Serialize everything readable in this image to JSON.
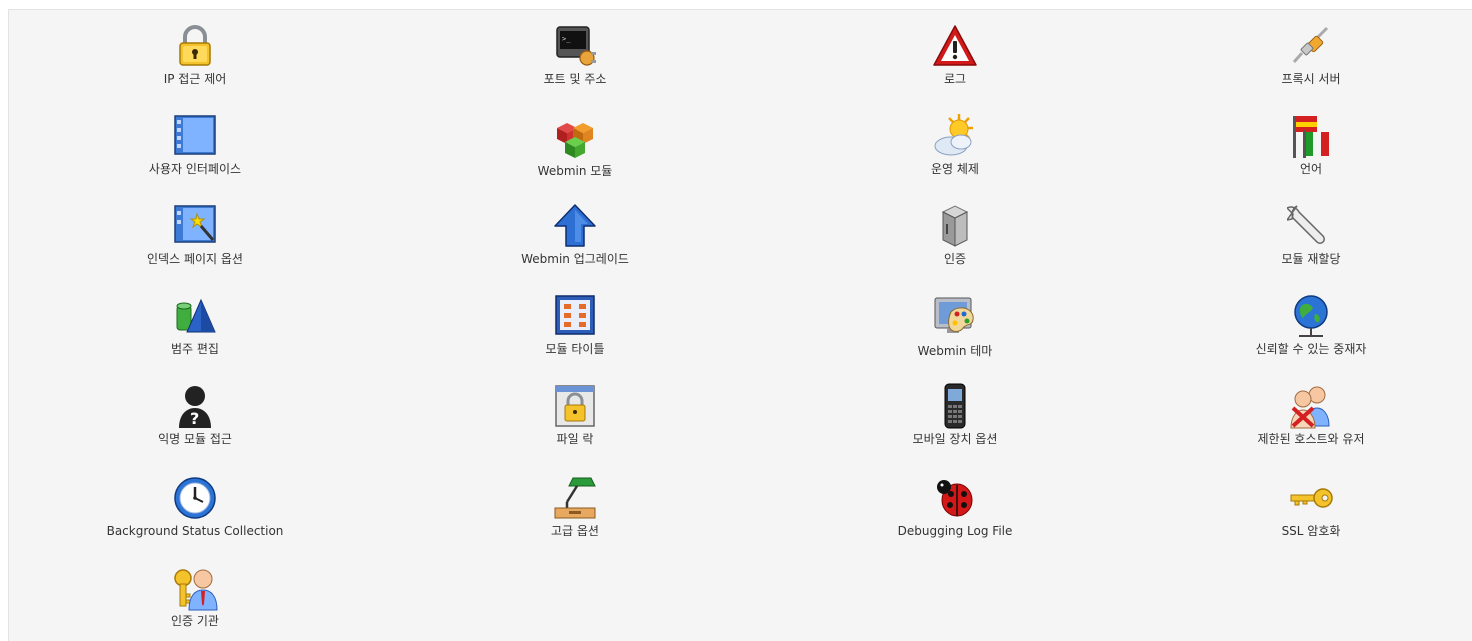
{
  "modules": [
    {
      "label": "IP 접근 제어",
      "icon": "padlock-icon"
    },
    {
      "label": "포트 및 주소",
      "icon": "terminal-plug-icon"
    },
    {
      "label": "로그",
      "icon": "warning-triangle-icon"
    },
    {
      "label": "프록시 서버",
      "icon": "cable-connector-icon"
    },
    {
      "label": "사용자 인터페이스",
      "icon": "window-icon"
    },
    {
      "label": "Webmin 모듈",
      "icon": "cubes-icon"
    },
    {
      "label": "운영 체제",
      "icon": "sun-cloud-icon"
    },
    {
      "label": "언어",
      "icon": "flags-icon"
    },
    {
      "label": "인덱스 페이지 옵션",
      "icon": "window-wand-icon"
    },
    {
      "label": "Webmin 업그레이드",
      "icon": "up-arrow-icon"
    },
    {
      "label": "인증",
      "icon": "server-box-icon"
    },
    {
      "label": "모듈 재할당",
      "icon": "wrench-icon"
    },
    {
      "label": "범주 편집",
      "icon": "shapes-icon"
    },
    {
      "label": "모듈 타이틀",
      "icon": "grid-window-icon"
    },
    {
      "label": "Webmin 테마",
      "icon": "monitor-palette-icon"
    },
    {
      "label": "신뢰할 수 있는 중재자",
      "icon": "globe-network-icon"
    },
    {
      "label": "익명 모듈 접근",
      "icon": "anonymous-user-icon"
    },
    {
      "label": "파일 락",
      "icon": "locked-window-icon"
    },
    {
      "label": "모바일 장치 옵션",
      "icon": "mobile-phone-icon"
    },
    {
      "label": "제한된 호스트와 유저",
      "icon": "users-denied-icon"
    },
    {
      "label": "Background Status Collection",
      "icon": "clock-icon"
    },
    {
      "label": "고급 옵션",
      "icon": "desk-lamp-icon"
    },
    {
      "label": "Debugging Log File",
      "icon": "ladybug-icon"
    },
    {
      "label": "SSL 암호화",
      "icon": "key-icon"
    },
    {
      "label": "인증 기관",
      "icon": "certificate-user-icon"
    }
  ]
}
